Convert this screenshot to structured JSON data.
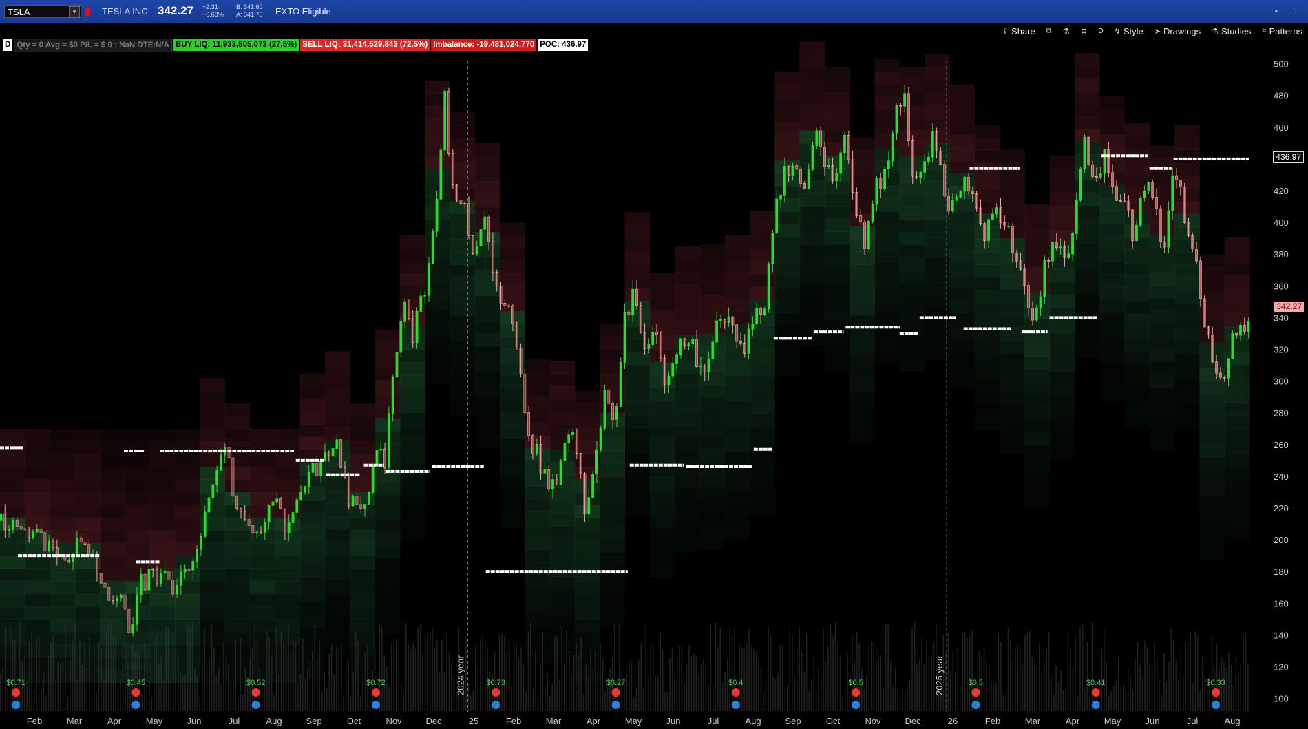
{
  "header": {
    "symbol": "TSLA",
    "company": "TESLA INC",
    "last": "342.27",
    "change": "+2.31",
    "change_pct": "+0.68%",
    "bid": "B: 341.60",
    "ask": "A: 341.70",
    "exto": "EXTO Eligible"
  },
  "toolbar": {
    "share": "Share",
    "period": "D",
    "style": "Style",
    "drawings": "Drawings",
    "studies": "Studies",
    "patterns": "Patterns"
  },
  "infobar": {
    "d": "D",
    "position": "Qty = 0  Avg = $0  P/L = $ 0 : NaN  DTE:N/A",
    "buy_liq": "BUY LIQ: 11,933,505,073  (27.5%)",
    "sell_liq": "SELL LIQ: 31,414,529,843  (72.5%)",
    "imbalance": "Imbalance: -19,481,024,770",
    "poc": "POC: 436.97"
  },
  "price_tags": {
    "poc": "436.97",
    "last": "342.27"
  },
  "colors": {
    "up": "#33d633",
    "down": "#ff9c9c",
    "buy_zone": "#1f5a32",
    "sell_zone": "#5a1e24",
    "poc_line": "#ffffff"
  },
  "chart_data": {
    "type": "candlestick",
    "y_ticks": [
      500,
      480,
      460,
      440,
      420,
      400,
      380,
      360,
      340,
      320,
      300,
      280,
      260,
      240,
      220,
      200,
      180,
      160,
      140,
      120,
      100
    ],
    "ylim": [
      92,
      502
    ],
    "x_ticks": [
      "Feb",
      "Mar",
      "Apr",
      "May",
      "Jun",
      "Jul",
      "Aug",
      "Sep",
      "Oct",
      "Nov",
      "Dec",
      "25",
      "Feb",
      "Mar",
      "Apr",
      "May",
      "Jun",
      "Jul",
      "Aug",
      "Sep",
      "Oct",
      "Nov",
      "Dec",
      "26",
      "Feb",
      "Mar",
      "Apr",
      "May",
      "Jun",
      "Jul",
      "Aug"
    ],
    "year_markers": [
      "2024 year",
      "2025 year"
    ],
    "close_path": [
      [
        0,
        212
      ],
      [
        2,
        200
      ],
      [
        3.5,
        183
      ],
      [
        4,
        205
      ],
      [
        4.5,
        186
      ],
      [
        5.3,
        170
      ],
      [
        6,
        160
      ],
      [
        6.5,
        143
      ],
      [
        7,
        172
      ],
      [
        7.5,
        176
      ],
      [
        8,
        178
      ],
      [
        8.7,
        170
      ],
      [
        9.2,
        176
      ],
      [
        9.8,
        190
      ],
      [
        10.3,
        220
      ],
      [
        10.7,
        240
      ],
      [
        11.2,
        262
      ],
      [
        11.7,
        225
      ],
      [
        12.2,
        214
      ],
      [
        12.7,
        198
      ],
      [
        13.2,
        210
      ],
      [
        13.7,
        225
      ],
      [
        14.3,
        205
      ],
      [
        14.8,
        222
      ],
      [
        15.3,
        238
      ],
      [
        15.8,
        246
      ],
      [
        16.3,
        250
      ],
      [
        16.8,
        260
      ],
      [
        17.3,
        228
      ],
      [
        17.8,
        217
      ],
      [
        18.3,
        230
      ],
      [
        18.8,
        262
      ],
      [
        19.2,
        250
      ],
      [
        19.6,
        305
      ],
      [
        20.2,
        350
      ],
      [
        20.6,
        330
      ],
      [
        21.2,
        357
      ],
      [
        21.8,
        420
      ],
      [
        22.2,
        480
      ],
      [
        22.6,
        420
      ],
      [
        23.2,
        405
      ],
      [
        23.7,
        380
      ],
      [
        24.2,
        400
      ],
      [
        24.7,
        360
      ],
      [
        25.2,
        350
      ],
      [
        25.7,
        335
      ],
      [
        26.1,
        290
      ],
      [
        26.6,
        260
      ],
      [
        27.2,
        240
      ],
      [
        27.7,
        230
      ],
      [
        28.2,
        256
      ],
      [
        28.7,
        270
      ],
      [
        29.2,
        222
      ],
      [
        29.7,
        250
      ],
      [
        30.2,
        290
      ],
      [
        30.7,
        270
      ],
      [
        31.2,
        340
      ],
      [
        31.7,
        355
      ],
      [
        32.2,
        320
      ],
      [
        32.7,
        330
      ],
      [
        33.2,
        300
      ],
      [
        33.7,
        320
      ],
      [
        34.2,
        325
      ],
      [
        34.7,
        318
      ],
      [
        35.2,
        300
      ],
      [
        35.7,
        330
      ],
      [
        36.2,
        342
      ],
      [
        36.7,
        335
      ],
      [
        37.2,
        318
      ],
      [
        37.7,
        347
      ],
      [
        38.2,
        345
      ],
      [
        38.7,
        410
      ],
      [
        39.2,
        430
      ],
      [
        39.7,
        440
      ],
      [
        40.2,
        420
      ],
      [
        40.7,
        460
      ],
      [
        41.2,
        440
      ],
      [
        41.7,
        426
      ],
      [
        42.2,
        460
      ],
      [
        42.7,
        410
      ],
      [
        43.2,
        387
      ],
      [
        43.7,
        425
      ],
      [
        44.2,
        430
      ],
      [
        44.7,
        467
      ],
      [
        45.2,
        480
      ],
      [
        45.7,
        425
      ],
      [
        46.2,
        432
      ],
      [
        46.7,
        455
      ],
      [
        47.2,
        418
      ],
      [
        47.7,
        405
      ],
      [
        48.2,
        430
      ],
      [
        48.7,
        412
      ],
      [
        49.2,
        395
      ],
      [
        49.7,
        410
      ],
      [
        50.2,
        400
      ],
      [
        50.7,
        380
      ],
      [
        51.2,
        360
      ],
      [
        51.7,
        340
      ],
      [
        52.2,
        372
      ],
      [
        52.7,
        390
      ],
      [
        53.2,
        378
      ],
      [
        53.7,
        400
      ],
      [
        54.2,
        452
      ],
      [
        54.7,
        428
      ],
      [
        55.2,
        440
      ],
      [
        55.7,
        412
      ],
      [
        56.2,
        410
      ],
      [
        56.7,
        390
      ],
      [
        57.2,
        425
      ],
      [
        57.7,
        412
      ],
      [
        58.2,
        380
      ],
      [
        58.7,
        435
      ],
      [
        59.2,
        406
      ],
      [
        59.7,
        384
      ],
      [
        60.2,
        330
      ],
      [
        60.7,
        315
      ],
      [
        61.1,
        302
      ],
      [
        61.6,
        325
      ],
      [
        62.1,
        332
      ],
      [
        62.5,
        342
      ]
    ],
    "poc_segments": [
      [
        0,
        1.2,
        258
      ],
      [
        6.2,
        7.2,
        256
      ],
      [
        8,
        14.7,
        256
      ],
      [
        14.8,
        16.2,
        250
      ],
      [
        16.3,
        18,
        241
      ],
      [
        18.2,
        19.2,
        247
      ],
      [
        19.3,
        21.5,
        243
      ],
      [
        21.6,
        24.2,
        246
      ],
      [
        0.9,
        5,
        190
      ],
      [
        6.8,
        8,
        186
      ],
      [
        24.3,
        31.4,
        180
      ],
      [
        31.5,
        34.2,
        247
      ],
      [
        34.3,
        37.6,
        246
      ],
      [
        37.7,
        38.6,
        257
      ],
      [
        38.7,
        40.6,
        327
      ],
      [
        40.7,
        42.2,
        331
      ],
      [
        42.3,
        45,
        334
      ],
      [
        45,
        45.9,
        330
      ],
      [
        46,
        47.8,
        340
      ],
      [
        48.2,
        50.6,
        333
      ],
      [
        51.1,
        52.4,
        331
      ],
      [
        52.5,
        54.9,
        340
      ],
      [
        55.1,
        57.4,
        442
      ],
      [
        57.5,
        58.6,
        434
      ],
      [
        58.7,
        62.5,
        440
      ],
      [
        48.5,
        51,
        434
      ]
    ],
    "dividend_labels": [
      "$0.71",
      "$0.45",
      "$0.52",
      "$0.72",
      "$0.73",
      "$0.27",
      "$0.4",
      "$0.5",
      "$0.5",
      "$0.41",
      "$0.33"
    ]
  }
}
